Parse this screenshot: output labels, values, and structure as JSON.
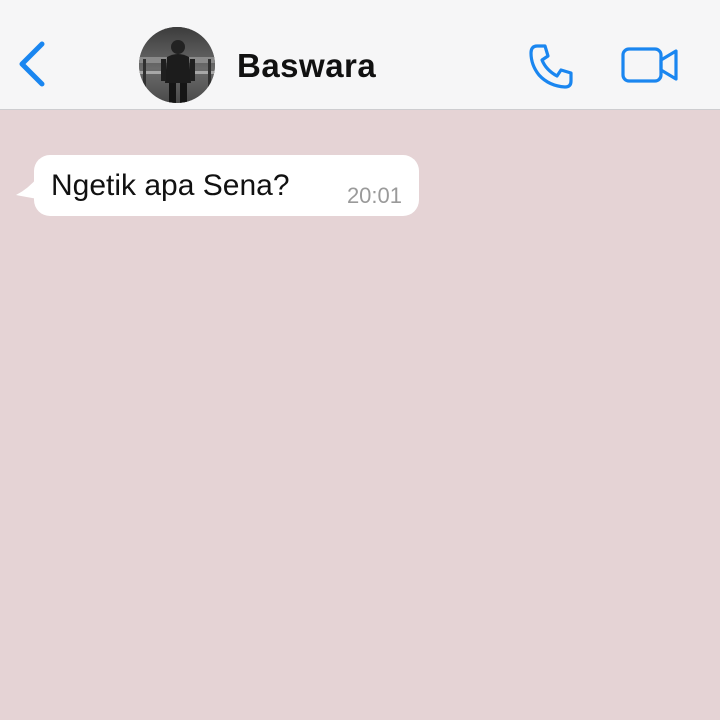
{
  "header": {
    "contact_name": "Baswara",
    "avatar_icon": "person-photo-avatar",
    "back_icon": "chevron-left-icon",
    "call_icon": "phone-icon",
    "video_icon": "video-camera-icon"
  },
  "colors": {
    "accent": "#1a86f0",
    "chat_background": "#e5d3d5",
    "header_background": "#f6f6f7",
    "bubble_background": "#ffffff"
  },
  "messages": [
    {
      "text": "Ngetik apa Sena?",
      "time": "20:01",
      "direction": "incoming"
    }
  ]
}
